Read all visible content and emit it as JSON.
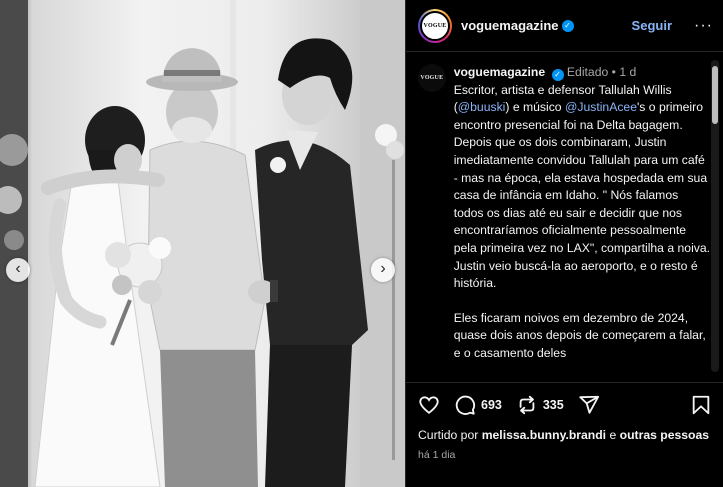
{
  "header": {
    "avatar_text": "VOGUE",
    "username": "voguemagazine",
    "follow_label": "Seguir",
    "more_label": "···"
  },
  "photo": {
    "prev_label": "‹",
    "next_label": "›",
    "tone": "black-and-white"
  },
  "caption": {
    "avatar_text": "VOGUE",
    "username": "voguemagazine",
    "edited": "Editado",
    "separator": "•",
    "age": "1 d",
    "p1_part1": "Escritor, artista e defensor Tallulah Willis (",
    "mention1": "@buuski",
    "p1_part2": ") e músico ",
    "mention2": "@JustinAcee",
    "p1_part3": "'s o primeiro encontro presencial foi na Delta bagagem. Depois que os dois combinaram, Justin imediatamente convidou Tallulah para um café - mas na época, ela estava hospedada em sua casa de infância em Idaho. \" Nós falamos todos os dias até eu sair e decidir que nos encontraríamos oficialmente pessoalmente pela primeira vez no LAX\", compartilha a noiva. Justin veio buscá-la ao aeroporto, e o resto é história.",
    "p2": "Eles ficaram noivos em dezembro de 2024, quase dois anos depois de começarem a falar, e o casamento deles"
  },
  "actions": {
    "comments_count": "693",
    "reposts_count": "335"
  },
  "likes": {
    "prefix": "Curtido por",
    "user": "melissa.bunny.brandi",
    "connector": "e",
    "others": "outras pessoas"
  },
  "time": "há 1 dia",
  "colors": {
    "link": "#8ab4f8",
    "verified": "#0095f6",
    "muted": "#a8a8a8"
  }
}
